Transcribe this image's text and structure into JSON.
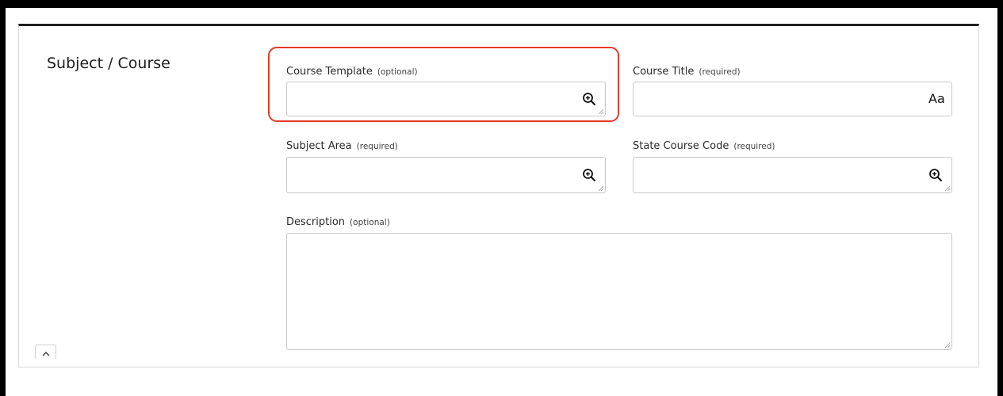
{
  "section": {
    "title": "Subject / Course"
  },
  "fields": {
    "course_template": {
      "label": "Course Template",
      "hint": "(optional)",
      "value": ""
    },
    "course_title": {
      "label": "Course Title",
      "hint": "(required)",
      "value": "",
      "icon_text": "Aa"
    },
    "subject_area": {
      "label": "Subject Area",
      "hint": "(required)",
      "value": ""
    },
    "state_course_code": {
      "label": "State Course Code",
      "hint": "(required)",
      "value": ""
    },
    "description": {
      "label": "Description",
      "hint": "(optional)",
      "value": ""
    }
  },
  "icons": {
    "lookup": "zoom-in-magnifier",
    "format": "text-case-aa",
    "collapse": "chevron-up"
  },
  "colors": {
    "highlight": "#e53a2a",
    "panel_border_top": "#1f1f1f",
    "input_border": "#c8c8c8"
  }
}
